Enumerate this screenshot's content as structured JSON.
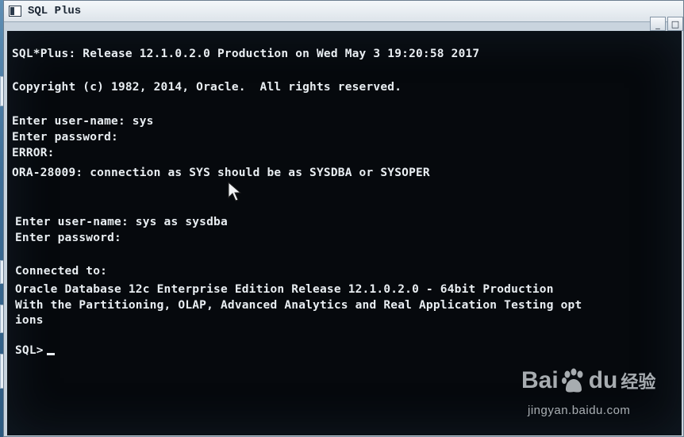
{
  "window": {
    "title": "SQL Plus",
    "controls": [
      "_",
      "□"
    ]
  },
  "console": {
    "lines": [
      "SQL*Plus: Release 12.1.0.2.0 Production on Wed May 3 19:20:58 2017",
      "Copyright (c) 1982, 2014, Oracle.  All rights reserved.",
      "Enter user-name: sys",
      "Enter password:",
      "ERROR:",
      "ORA-28009: connection as SYS should be as SYSDBA or SYSOPER",
      "Enter user-name: sys as sysdba",
      "Enter password:",
      "Connected to:",
      "Oracle Database 12c Enterprise Edition Release 12.1.0.2.0 - 64bit Production",
      "With the Partitioning, OLAP, Advanced Analytics and Real Application Testing opt",
      "ions"
    ],
    "prompt": "SQL>"
  },
  "watermark": {
    "logo_left": "Bai",
    "logo_right": "du",
    "logo_cn": "经验",
    "url": "jingyan.baidu.com"
  },
  "colors": {
    "console_bg": "#06090d",
    "console_text": "#e9eef2"
  }
}
